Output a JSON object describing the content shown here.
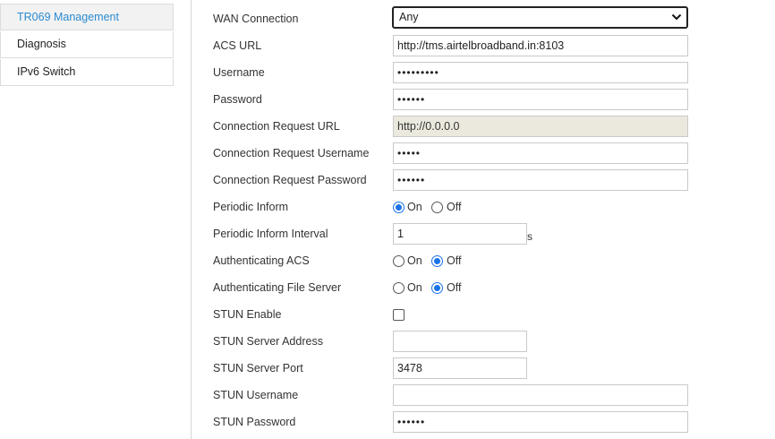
{
  "sidebar": {
    "items": [
      {
        "label": "TR069 Management",
        "active": true
      },
      {
        "label": "Diagnosis",
        "active": false
      },
      {
        "label": "IPv6 Switch",
        "active": false
      }
    ]
  },
  "form": {
    "wan_connection": {
      "label": "WAN Connection",
      "value": "Any"
    },
    "acs_url": {
      "label": "ACS URL",
      "value": "http://tms.airtelbroadband.in:8103"
    },
    "username": {
      "label": "Username",
      "value": "•••••••••"
    },
    "password": {
      "label": "Password",
      "value": "••••••"
    },
    "conn_req_url": {
      "label": "Connection Request URL",
      "value": "http://0.0.0.0"
    },
    "conn_req_username": {
      "label": "Connection Request Username",
      "value": "•••••"
    },
    "conn_req_password": {
      "label": "Connection Request Password",
      "value": "••••••"
    },
    "periodic_inform": {
      "label": "Periodic Inform",
      "on_label": "On",
      "off_label": "Off",
      "selected": "On"
    },
    "periodic_inform_interval": {
      "label": "Periodic Inform Interval",
      "value": "1",
      "unit": "s"
    },
    "auth_acs": {
      "label": "Authenticating ACS",
      "on_label": "On",
      "off_label": "Off",
      "selected": "Off"
    },
    "auth_file_server": {
      "label": "Authenticating File Server",
      "on_label": "On",
      "off_label": "Off",
      "selected": "Off"
    },
    "stun_enable": {
      "label": "STUN Enable",
      "checked": false
    },
    "stun_server_address": {
      "label": "STUN Server Address",
      "value": ""
    },
    "stun_server_port": {
      "label": "STUN Server Port",
      "value": "3478"
    },
    "stun_username": {
      "label": "STUN Username",
      "value": ""
    },
    "stun_password": {
      "label": "STUN Password",
      "value": "••••••"
    }
  },
  "colors": {
    "accent": "#2a8bd2",
    "radio_selected": "#1a73e8",
    "readonly_bg": "#ebe9de"
  },
  "icons": {
    "select_arrow": "chevron-down-icon"
  }
}
